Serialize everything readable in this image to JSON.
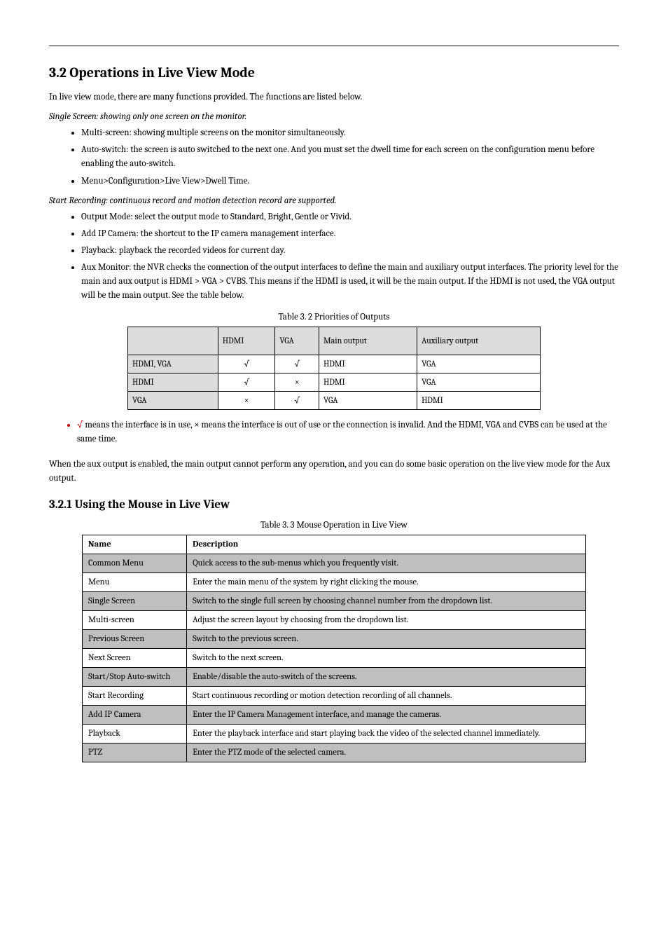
{
  "header": {
    "left": "",
    "right": "",
    "page": ""
  },
  "section_title": "3.2 Operations in Live View Mode",
  "intro": "In live view mode, there are many functions provided. The functions are listed below.",
  "block1": {
    "lead": "Single Screen: showing only one screen on the monitor.",
    "bullets": [
      "Multi-screen: showing multiple screens on the monitor simultaneously.",
      "Auto-switch: the screen is auto switched to the next one. And you must set the dwell time for each screen on the configuration menu before enabling the auto-switch.",
      "Menu>Configuration>Live View>Dwell Time."
    ]
  },
  "block2_lead": "Start Recording: continuous record and motion detection record are supported.",
  "block2_bullets": [
    "Output Mode: select the output mode to Standard, Bright, Gentle or Vivid.",
    "Add IP Camera: the shortcut to the IP camera management interface.",
    "Playback: playback the recorded videos for current day.",
    "Aux Monitor: the NVR checks the connection of the output interfaces to define the main and auxiliary output interfaces. The priority level for the main and aux output is HDMI > VGA > CVBS. This means if the HDMI is used, it will be the main output. If the HDMI is not used, the VGA output will be the main output. See the table below."
  ],
  "table1": {
    "caption": "Table 3. 2 Priorities of Outputs",
    "headers": [
      "",
      "HDMI",
      "VGA",
      "Main output",
      "Auxiliary output"
    ],
    "rows": [
      [
        "HDMI, VGA",
        "√",
        "√",
        "HDMI",
        "VGA"
      ],
      [
        "HDMI",
        "√",
        "×",
        "HDMI",
        "VGA"
      ],
      [
        "VGA",
        "×",
        "√",
        "VGA",
        "HDMI"
      ]
    ]
  },
  "note_prefix": "√",
  "note": "  means the interface is in use, × means the interface is out of use or the connection is invalid. And the HDMI, VGA and CVBS can be used at the same time.",
  "aux_para": "When the aux output is enabled, the main output cannot perform any operation, and you can do some basic operation on the live view mode for the Aux output.",
  "subsection_title": "3.2.1 Using the Mouse in Live View",
  "table2": {
    "caption": "Table 3. 3 Mouse Operation in Live View",
    "headers": [
      "Name",
      "Description"
    ],
    "rows": [
      [
        "Common Menu",
        "Quick access to the sub-menus which you frequently visit."
      ],
      [
        "Menu",
        "Enter the main menu of the system by right clicking the mouse."
      ],
      [
        "Single Screen",
        "Switch to the single full screen by choosing channel number from the dropdown list."
      ],
      [
        "Multi-screen",
        "Adjust the screen layout by choosing from the dropdown list."
      ],
      [
        "Previous Screen",
        "Switch to the previous screen."
      ],
      [
        "Next Screen",
        "Switch to the next screen."
      ],
      [
        "Start/Stop Auto-switch",
        "Enable/disable the auto-switch of the screens."
      ],
      [
        "Start Recording",
        "Start continuous recording or motion detection recording of all channels."
      ],
      [
        "Add IP Camera",
        "Enter the IP Camera Management interface, and manage the cameras."
      ],
      [
        "Playback",
        "Enter the playback interface and start playing back the video of the selected channel immediately."
      ],
      [
        "PTZ",
        "Enter the PTZ mode of the selected camera."
      ]
    ]
  }
}
